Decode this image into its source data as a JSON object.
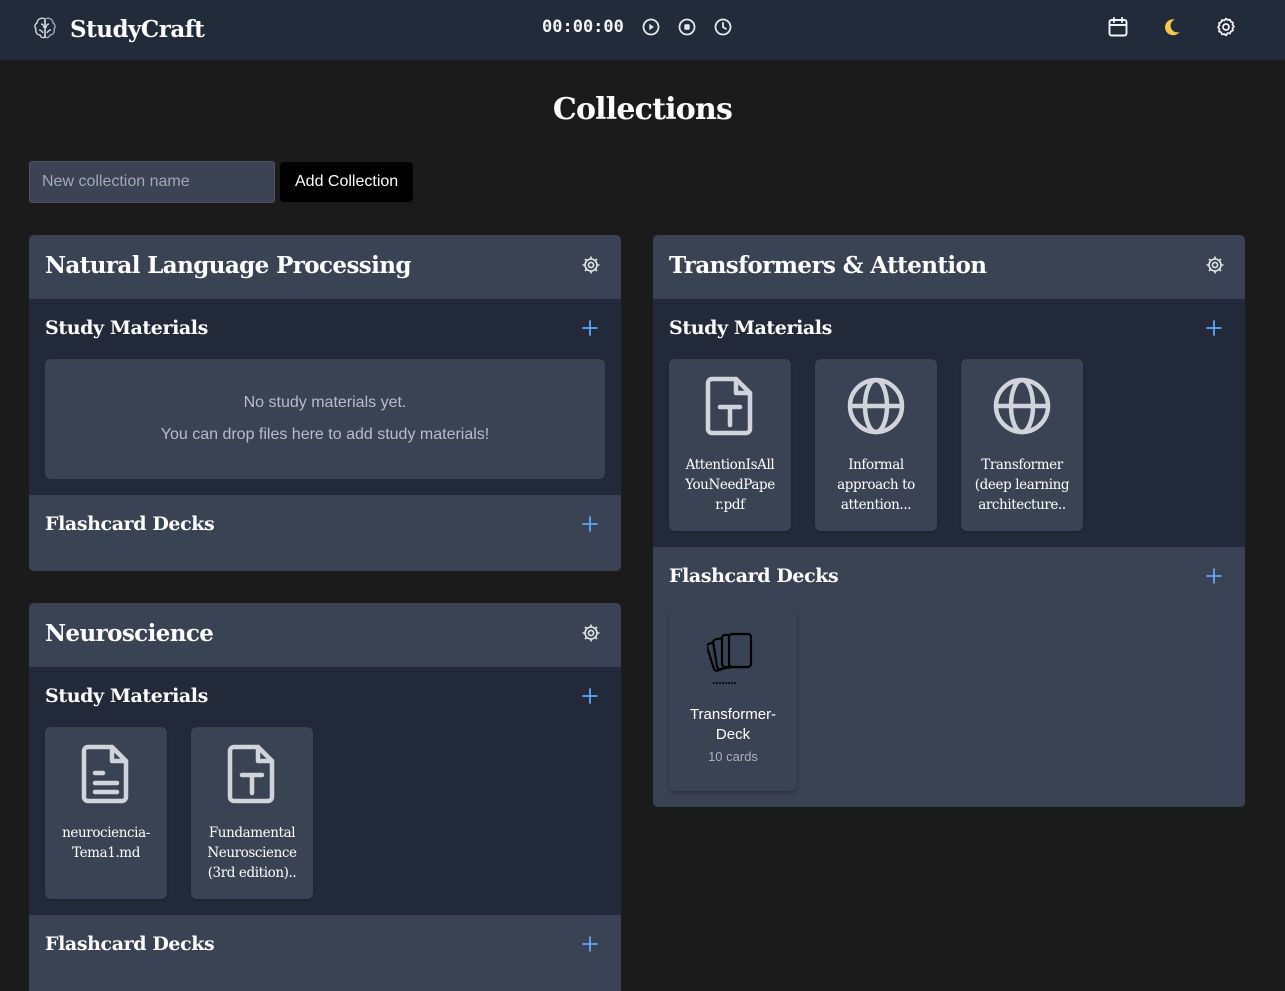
{
  "header": {
    "app_name": "StudyCraft",
    "timer": "00:00:00"
  },
  "page": {
    "title": "Collections",
    "new_collection_placeholder": "New collection name",
    "add_collection_label": "Add Collection"
  },
  "collections": [
    {
      "title": "Natural Language Processing",
      "study_materials_label": "Study Materials",
      "empty_line1": "No study materials yet.",
      "empty_line2": "You can drop files here to add study materials!",
      "flashcard_decks_label": "Flashcard Decks"
    },
    {
      "title": "Transformers & Attention",
      "study_materials_label": "Study Materials",
      "materials": [
        {
          "icon": "text-file-icon",
          "line1": "AttentionIsAll",
          "line2": "YouNeedPape",
          "line3": "r.pdf"
        },
        {
          "icon": "globe-icon",
          "line1": "Informal",
          "line2": "approach to",
          "line3": "attention..."
        },
        {
          "icon": "globe-icon",
          "line1": "Transformer",
          "line2": "(deep learning",
          "line3": "architecture.."
        }
      ],
      "flashcard_decks_label": "Flashcard Decks",
      "decks": [
        {
          "icon": "cards-stack-icon",
          "name_line1": "Transformer-",
          "name_line2": "Deck",
          "count": "10 cards"
        }
      ]
    },
    {
      "title": "Neuroscience",
      "study_materials_label": "Study Materials",
      "materials": [
        {
          "icon": "document-icon",
          "line1": "neurociencia-",
          "line2": "Tema1.md",
          "line3": ""
        },
        {
          "icon": "text-file-icon",
          "line1": "Fundamental",
          "line2": "Neuroscience",
          "line3": "(3rd edition).."
        }
      ],
      "flashcard_decks_label": "Flashcard Decks"
    }
  ]
}
